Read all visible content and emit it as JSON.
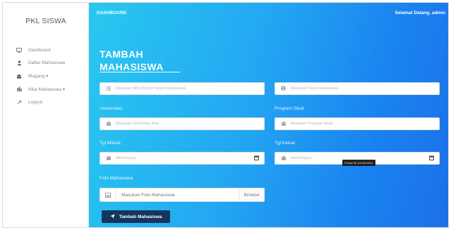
{
  "sidebar": {
    "brand": "PKL SISWA",
    "items": [
      {
        "label": "Dashboard",
        "icon": "monitor-icon"
      },
      {
        "label": "Daftar Mahasiswa",
        "icon": "user-icon"
      },
      {
        "label": "Magang ▾",
        "icon": "building-icon"
      },
      {
        "label": "Nilai Mahasiswa ▾",
        "icon": "bar-chart-icon"
      },
      {
        "label": "Logout",
        "icon": "logout-icon"
      }
    ]
  },
  "topbar": {
    "section": "DASHBOARD",
    "welcome": "Selamat Datang, admin"
  },
  "form": {
    "title": "TAMBAH MAHASISWA",
    "nim_placeholder": "Masukan NIM (Nomor Induk Mahasiswa)",
    "nama_placeholder": "Masukan Nama Mahasiswa",
    "universitas_label": "Universitas",
    "universitas_placeholder": "Masukan Univesitas Asal",
    "prodi_label": "Program Studi",
    "prodi_placeholder": "Masukan Program Studi",
    "tgl_masuk_label": "Tgl Masuk",
    "tgl_masuk_placeholder": "dd/mm/yyyy",
    "tgl_keluar_label": "Tgl Keluar",
    "tgl_keluar_placeholder": "dd/mm/yyyy",
    "tooltip": "Please fill out this field.",
    "foto_label": "Foto Mahasiswa",
    "foto_file_label": "Masukan Foto Mahasiswa",
    "browse_label": "Browse",
    "submit_label": "Tambah Mahasiswa"
  },
  "colors": {
    "gradient_start": "#29c8f0",
    "gradient_end": "#1c6fe8",
    "button": "#13355e"
  }
}
